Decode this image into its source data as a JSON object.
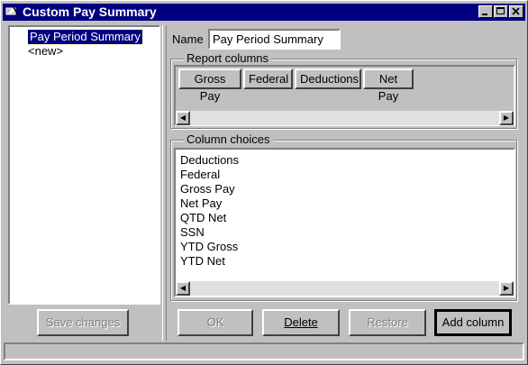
{
  "window": {
    "title": "Custom Pay Summary"
  },
  "left_list": {
    "items": [
      {
        "label": "Pay Period Summary",
        "selected": true
      },
      {
        "label": "<new>",
        "selected": false
      }
    ]
  },
  "left_button": {
    "label": "Save changes",
    "enabled": false
  },
  "name_field": {
    "label": "Name",
    "value": "Pay Period Summary"
  },
  "report_columns": {
    "title": "Report columns",
    "items": [
      "Gross Pay",
      "Federal",
      "Deductions",
      "Net Pay"
    ]
  },
  "column_choices": {
    "title": "Column choices",
    "items": [
      "Deductions",
      "Federal",
      "Gross Pay",
      "Net Pay",
      "QTD Net",
      "SSN",
      "YTD Gross",
      "YTD Net"
    ]
  },
  "buttons": {
    "ok": "OK",
    "delete": "Delete",
    "restore": "Restore",
    "add_column": "Add column"
  },
  "colors": {
    "titlebar": "#000080",
    "face": "#c0c0c0",
    "selection": "#000080"
  }
}
